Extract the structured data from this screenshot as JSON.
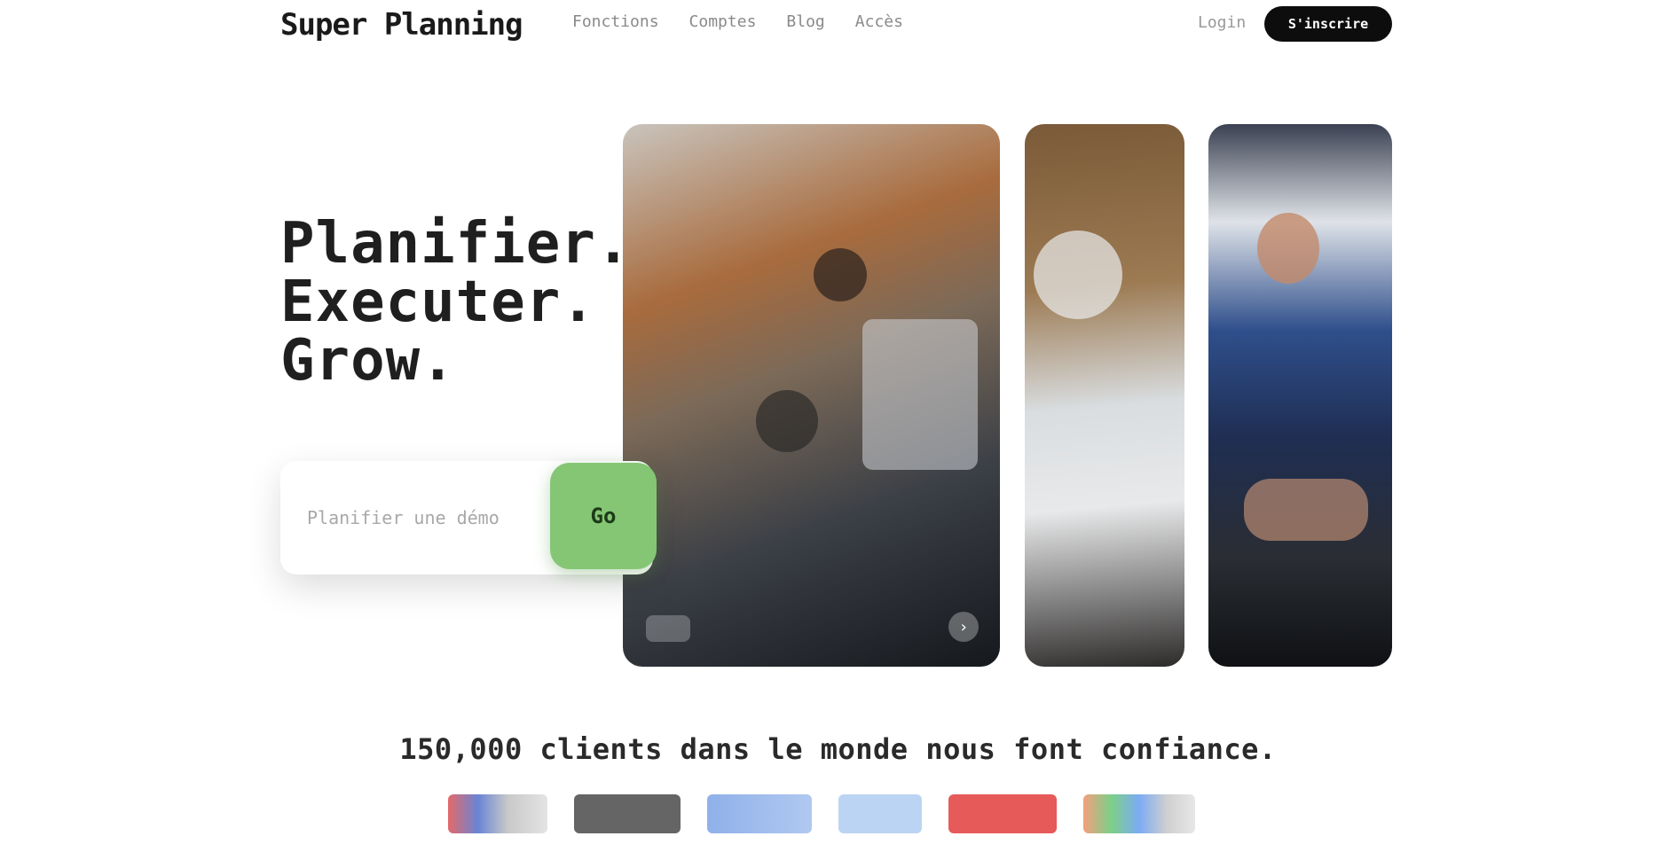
{
  "nav": {
    "brand": "Super Planning",
    "links": [
      "Fonctions",
      "Comptes",
      "Blog",
      "Accès"
    ],
    "login": "Login",
    "cta": "S'inscrire"
  },
  "hero": {
    "headline": [
      "Planifier.",
      "Executer.",
      "Grow."
    ],
    "input_placeholder": "Planifier une démo",
    "go_button": "Go"
  },
  "trust": {
    "text": "150,000 clients dans le monde nous font confiance."
  },
  "colors": {
    "accent_green": "#85c675",
    "cta_bg": "#0d0d0d"
  }
}
